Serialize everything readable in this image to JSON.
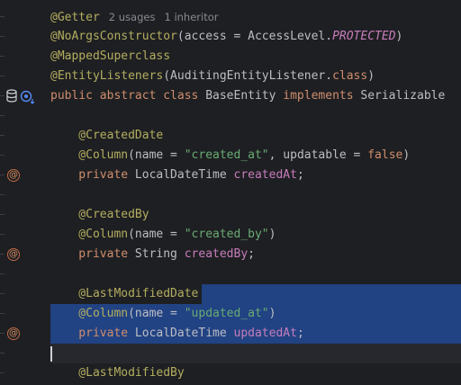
{
  "editor": {
    "hint": {
      "usages": "2 usages",
      "inheritor": "1 inheritor"
    },
    "lines": [
      {
        "tokens": [
          {
            "t": "@Getter",
            "c": "ann"
          }
        ],
        "hint": true
      },
      {
        "tokens": [
          {
            "t": "@NoArgsConstructor",
            "c": "ann"
          },
          {
            "t": "(access = AccessLevel.",
            "c": ""
          },
          {
            "t": "PROTECTED",
            "c": "cst"
          },
          {
            "t": ")",
            "c": ""
          }
        ]
      },
      {
        "tokens": [
          {
            "t": "@MappedSuperclass",
            "c": "ann"
          }
        ]
      },
      {
        "tokens": [
          {
            "t": "@EntityListeners",
            "c": "ann"
          },
          {
            "t": "(AuditingEntityListener.",
            "c": ""
          },
          {
            "t": "class",
            "c": "kw"
          },
          {
            "t": ")",
            "c": ""
          }
        ]
      },
      {
        "tokens": [
          {
            "t": "public abstract class ",
            "c": "kw"
          },
          {
            "t": "BaseEntity ",
            "c": ""
          },
          {
            "t": "implements ",
            "c": "kw"
          },
          {
            "t": "Serializable",
            "c": ""
          }
        ],
        "gutter": "db-icons"
      },
      {
        "tokens": []
      },
      {
        "tokens": [
          {
            "t": "    @CreatedDate",
            "c": "ann"
          }
        ]
      },
      {
        "tokens": [
          {
            "t": "    @Column",
            "c": "ann"
          },
          {
            "t": "(name = ",
            "c": ""
          },
          {
            "t": "\"created_at\"",
            "c": "str"
          },
          {
            "t": ", updatable = ",
            "c": ""
          },
          {
            "t": "false",
            "c": "kw"
          },
          {
            "t": ")",
            "c": ""
          }
        ]
      },
      {
        "tokens": [
          {
            "t": "    private ",
            "c": "kw"
          },
          {
            "t": "LocalDateTime ",
            "c": ""
          },
          {
            "t": "createdAt",
            "c": "fld"
          },
          {
            "t": ";",
            "c": ""
          }
        ],
        "gutter": "at"
      },
      {
        "tokens": []
      },
      {
        "tokens": [
          {
            "t": "    @CreatedBy",
            "c": "ann"
          }
        ]
      },
      {
        "tokens": [
          {
            "t": "    @Column",
            "c": "ann"
          },
          {
            "t": "(name = ",
            "c": ""
          },
          {
            "t": "\"created_by\"",
            "c": "str"
          },
          {
            "t": ")",
            "c": ""
          }
        ]
      },
      {
        "tokens": [
          {
            "t": "    private ",
            "c": "kw"
          },
          {
            "t": "String ",
            "c": ""
          },
          {
            "t": "createdBy",
            "c": "fld"
          },
          {
            "t": ";",
            "c": ""
          }
        ],
        "gutter": "at"
      },
      {
        "tokens": []
      },
      {
        "tokens": [
          {
            "t": "    @LastModifiedDate",
            "c": "ann"
          }
        ],
        "sel": "partial"
      },
      {
        "tokens": [
          {
            "t": "    @Column",
            "c": "ann"
          },
          {
            "t": "(name = ",
            "c": ""
          },
          {
            "t": "\"updated_at\"",
            "c": "str"
          },
          {
            "t": ")",
            "c": ""
          }
        ],
        "sel": "full"
      },
      {
        "tokens": [
          {
            "t": "    private ",
            "c": "kw"
          },
          {
            "t": "LocalDateTime ",
            "c": ""
          },
          {
            "t": "updatedAt",
            "c": "fld"
          },
          {
            "t": ";",
            "c": ""
          }
        ],
        "gutter": "at",
        "sel": "full"
      },
      {
        "tokens": [],
        "caret": true
      },
      {
        "tokens": [
          {
            "t": "    @LastModifiedBy",
            "c": "ann"
          }
        ]
      }
    ]
  },
  "icons": {
    "at": "@",
    "db": "database-icon",
    "impl": "implemented-icon"
  }
}
